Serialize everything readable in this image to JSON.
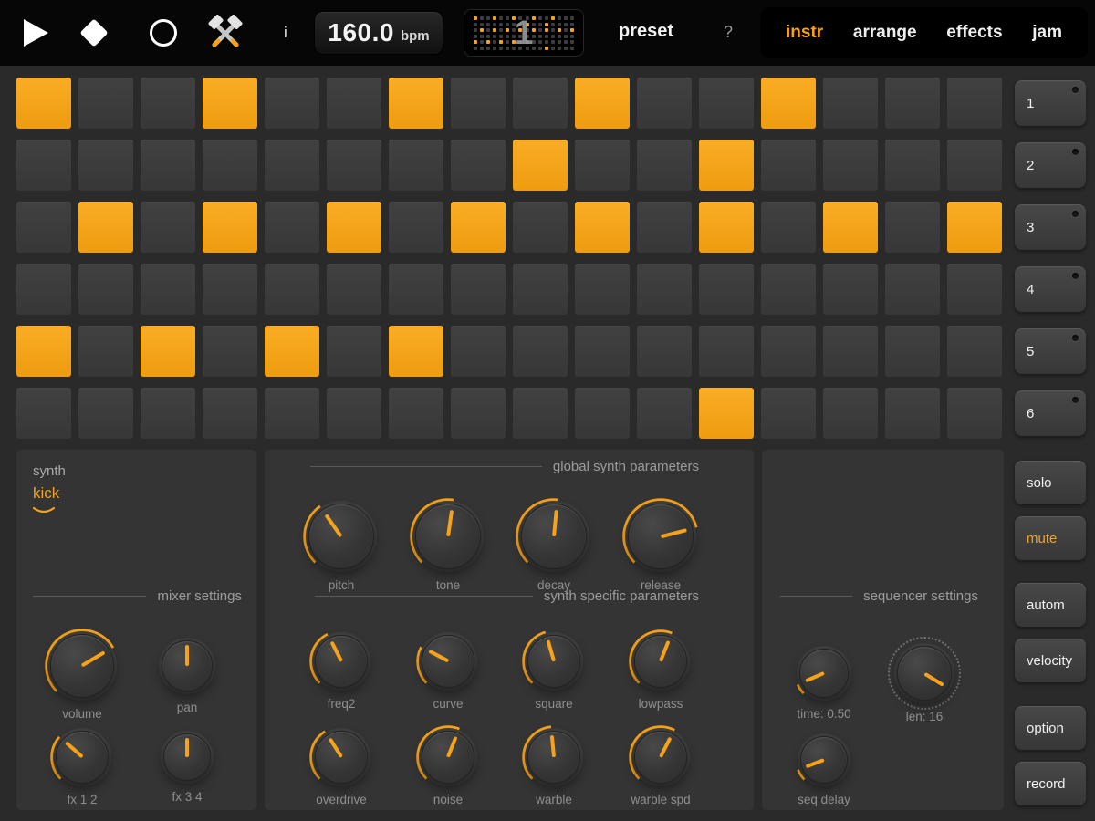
{
  "colors": {
    "accent": "#f6a21b"
  },
  "topbar": {
    "info_label": "i",
    "bpm_value": "160.0",
    "bpm_unit": "bpm",
    "bar_number": "1",
    "preset_label": "preset",
    "help_label": "?",
    "menu": [
      {
        "label": "instr",
        "active": true
      },
      {
        "label": "arrange",
        "active": false
      },
      {
        "label": "effects",
        "active": false
      },
      {
        "label": "jam",
        "active": false
      }
    ]
  },
  "grid": {
    "rows": 6,
    "cols": 16,
    "pattern": [
      [
        1,
        0,
        0,
        1,
        0,
        0,
        1,
        0,
        0,
        1,
        0,
        0,
        1,
        0,
        0,
        0
      ],
      [
        0,
        0,
        0,
        0,
        0,
        0,
        0,
        0,
        1,
        0,
        0,
        1,
        0,
        0,
        0,
        0
      ],
      [
        0,
        1,
        0,
        1,
        0,
        1,
        0,
        1,
        0,
        1,
        0,
        1,
        0,
        1,
        0,
        1
      ],
      [
        0,
        0,
        0,
        0,
        0,
        0,
        0,
        0,
        0,
        0,
        0,
        0,
        0,
        0,
        0,
        0
      ],
      [
        1,
        0,
        1,
        0,
        1,
        0,
        1,
        0,
        0,
        0,
        0,
        0,
        0,
        0,
        0,
        0
      ],
      [
        0,
        0,
        0,
        0,
        0,
        0,
        0,
        0,
        0,
        0,
        0,
        1,
        0,
        0,
        0,
        0
      ]
    ]
  },
  "sidebar": {
    "tracks": [
      "1",
      "2",
      "3",
      "4",
      "5",
      "6"
    ],
    "buttons": [
      {
        "label": "solo",
        "active": false
      },
      {
        "label": "mute",
        "active": true
      },
      {
        "label": "autom",
        "active": false
      },
      {
        "label": "velocity",
        "active": false
      },
      {
        "label": "option",
        "active": false
      },
      {
        "label": "record",
        "active": false
      }
    ]
  },
  "panels": {
    "synth": {
      "title": "synth",
      "selected": "kick",
      "header": "mixer settings",
      "knobs": [
        {
          "id": "volume",
          "label": "volume",
          "value": 0.72
        },
        {
          "id": "pan",
          "label": "pan",
          "value": 0.5,
          "bipolar": true
        },
        {
          "id": "fx12",
          "label": "fx 1 2",
          "value": 0.32
        },
        {
          "id": "fx34",
          "label": "fx 3 4",
          "value": 0.5,
          "bipolar": true
        }
      ]
    },
    "global": {
      "header": "global synth parameters",
      "knobs": [
        {
          "id": "pitch",
          "label": "pitch",
          "value": 0.37
        },
        {
          "id": "tone",
          "label": "tone",
          "value": 0.53
        },
        {
          "id": "decay",
          "label": "decay",
          "value": 0.52
        },
        {
          "id": "release",
          "label": "release",
          "value": 0.78
        }
      ]
    },
    "specific": {
      "header": "synth specific parameters",
      "knobs": [
        {
          "id": "freq2",
          "label": "freq2",
          "value": 0.4
        },
        {
          "id": "curve",
          "label": "curve",
          "value": 0.27
        },
        {
          "id": "square",
          "label": "square",
          "value": 0.44
        },
        {
          "id": "lowpass",
          "label": "lowpass",
          "value": 0.58
        },
        {
          "id": "overdrive",
          "label": "overdrive",
          "value": 0.38
        },
        {
          "id": "noise",
          "label": "noise",
          "value": 0.58
        },
        {
          "id": "warble",
          "label": "warble",
          "value": 0.48
        },
        {
          "id": "warblespd",
          "label": "warble spd",
          "value": 0.6
        }
      ]
    },
    "sequencer": {
      "header": "sequencer settings",
      "knobs": [
        {
          "id": "time",
          "label": "time: 0.50",
          "value": 0.08
        },
        {
          "id": "len",
          "label": "len: 16",
          "value": 0.95,
          "ticks": true,
          "showArc": false
        },
        {
          "id": "seqdelay",
          "label": "seq delay",
          "value": 0.09
        }
      ]
    }
  }
}
